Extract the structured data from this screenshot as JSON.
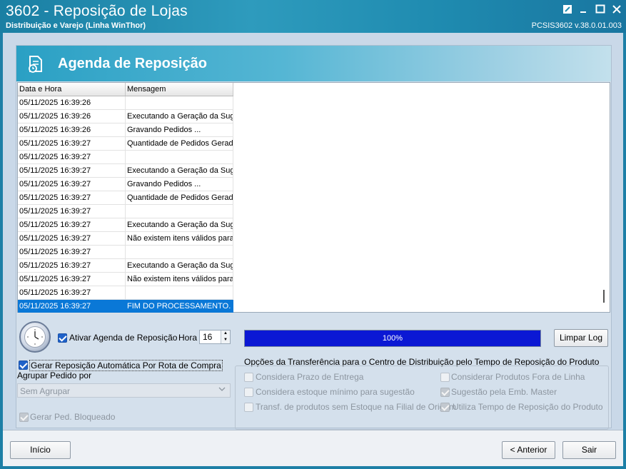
{
  "window": {
    "title": "3602 - Reposição de Lojas",
    "subtitle": "Distribuição e Varejo (Linha WinThor)",
    "version": "PCSIS3602  v.38.0.01.003"
  },
  "header": {
    "title": "Agenda de Reposição",
    "icon": "schedule-document-icon"
  },
  "grid": {
    "columns": [
      "Data e Hora",
      "Mensagem"
    ],
    "rows": [
      {
        "date": "05/11/2025 16:39:26",
        "message": ""
      },
      {
        "date": "05/11/2025 16:39:26",
        "message": "Executando a Geração da Suge"
      },
      {
        "date": "05/11/2025 16:39:26",
        "message": "Gravando Pedidos ..."
      },
      {
        "date": "05/11/2025 16:39:27",
        "message": "Quantidade de Pedidos Gerado"
      },
      {
        "date": "05/11/2025 16:39:27",
        "message": ""
      },
      {
        "date": "05/11/2025 16:39:27",
        "message": "Executando a Geração da Suge"
      },
      {
        "date": "05/11/2025 16:39:27",
        "message": "Gravando Pedidos ..."
      },
      {
        "date": "05/11/2025 16:39:27",
        "message": "Quantidade de Pedidos Gerado"
      },
      {
        "date": "05/11/2025 16:39:27",
        "message": ""
      },
      {
        "date": "05/11/2025 16:39:27",
        "message": "Executando a Geração da Suge"
      },
      {
        "date": "05/11/2025 16:39:27",
        "message": "Não existem itens válidos para"
      },
      {
        "date": "05/11/2025 16:39:27",
        "message": ""
      },
      {
        "date": "05/11/2025 16:39:27",
        "message": "Executando a Geração da Suge"
      },
      {
        "date": "05/11/2025 16:39:27",
        "message": "Não existem itens válidos para"
      },
      {
        "date": "05/11/2025 16:39:27",
        "message": ""
      },
      {
        "date": "05/11/2025 16:39:27",
        "message": "FIM DO PROCESSAMENTO.",
        "selected": true
      }
    ]
  },
  "schedule": {
    "activate_label": "Ativar Agenda de Reposição",
    "activate_checked": true,
    "hour_label": "Hora",
    "hour_value": "16"
  },
  "progress": {
    "value": 1.0,
    "text": "100%"
  },
  "buttons": {
    "clear_log": "Limpar Log",
    "start": "Início",
    "previous": "< Anterior",
    "exit": "Sair"
  },
  "auto_route": {
    "label": "Gerar Reposição Automática Por Rota de Compra",
    "checked": true
  },
  "group_by": {
    "label": "Agrupar Pedido por",
    "selected": "Sem Agrupar"
  },
  "blocked_order": {
    "label": "Gerar Ped. Bloqueado",
    "checked": true,
    "disabled": true
  },
  "transfer_options": {
    "title": "Opções da Transferência para o Centro de Distribuição pelo Tempo de Reposição do Produto",
    "left": [
      {
        "label": "Considera Prazo de Entrega",
        "checked": false
      },
      {
        "label": "Considera estoque mínimo para sugestão",
        "checked": false
      },
      {
        "label": "Transf. de produtos sem Estoque na Filial de Origem",
        "checked": false
      }
    ],
    "right": [
      {
        "label": "Considerar Produtos Fora de Linha",
        "checked": false
      },
      {
        "label": "Sugestão pela Emb. Master",
        "checked": true
      },
      {
        "label": "Utiliza Tempo de Reposição do Produto",
        "checked": true
      }
    ]
  },
  "colors": {
    "accent": "#2aa0c4",
    "selection": "#0a78d7",
    "progress": "#0b18d4"
  }
}
